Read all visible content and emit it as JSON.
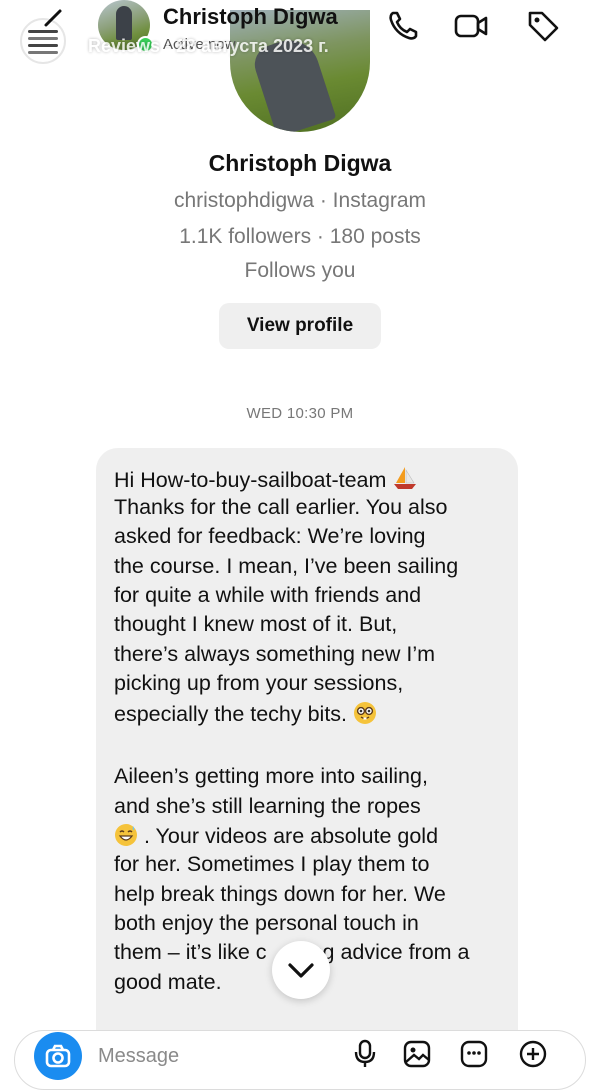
{
  "header": {
    "contact_name": "Christoph Digwa",
    "active_status": "Active now",
    "story_caption": "Reviews · 28 августа 2023 г."
  },
  "profile": {
    "name": "Christoph Digwa",
    "handle_line": "christophdigwa · Instagram",
    "stats_line": "1.1K followers · 180 posts",
    "follow_status": "Follows you",
    "view_profile_label": "View profile"
  },
  "chat": {
    "timestamp": "WED 10:30 PM",
    "message_lines": {
      "l1": "Hi How-to-buy-sailboat-team",
      "l2": "Thanks for the call earlier. You also",
      "l3": "asked for feedback: We’re loving",
      "l4": "the course. I mean, I’ve been sailing",
      "l5": "for quite a while with friends and",
      "l6": "thought I knew most of it. But,",
      "l7": "there’s always something new I’m",
      "l8": "picking up from your sessions,",
      "l9": "especially the techy bits.",
      "l10": "Aileen’s getting more into sailing,",
      "l11": "and she’s still learning the ropes",
      "l12": ". Your videos are absolute gold",
      "l13": "for her. Sometimes I play them to",
      "l14": "help break things down for her. We",
      "l15": "both enjoy the personal touch in",
      "l16a": "them – it’s like c",
      "l16b": "ng advice from a",
      "l17": "good mate."
    }
  },
  "composer": {
    "placeholder": "Message"
  },
  "colors": {
    "accent_blue": "#1a8cf0",
    "bubble_gray": "#efefef",
    "active_green": "#3bd15b"
  },
  "icons": [
    "back-chevron-icon",
    "phone-icon",
    "video-camera-icon",
    "tag-icon",
    "more-dots-icon",
    "close-icon",
    "chevron-down-icon",
    "camera-icon",
    "microphone-icon",
    "gallery-icon",
    "sticker-icon",
    "plus-icon",
    "sailboat-emoji",
    "nerd-face-emoji",
    "grinning-sweat-emoji"
  ]
}
